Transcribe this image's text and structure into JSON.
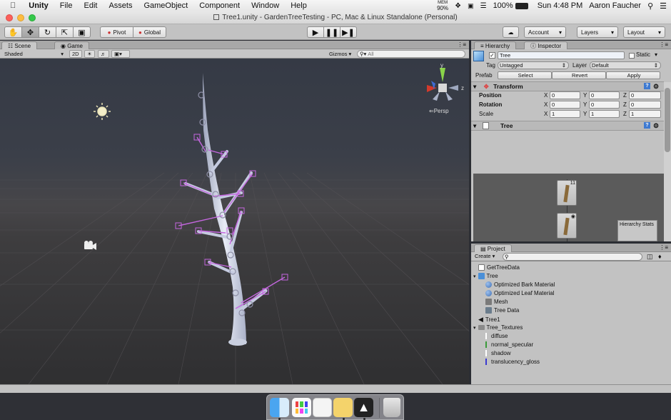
{
  "menubar": {
    "app": "Unity",
    "items": [
      "File",
      "Edit",
      "Assets",
      "GameObject",
      "Component",
      "Window",
      "Help"
    ],
    "mem_label": "MEM",
    "mem_value": "90%",
    "battery": "100%",
    "clock": "Sun 4:48 PM",
    "user": "Aaron Faucher"
  },
  "window": {
    "title": "Tree1.unity - GardenTreeTesting - PC, Mac & Linux Standalone (Personal)"
  },
  "toolbar": {
    "pivot": "Pivot",
    "global": "Global",
    "account": "Account",
    "layers": "Layers",
    "layout": "Layout"
  },
  "scene_tabs": {
    "scene": "Scene",
    "game": "Game",
    "shaded": "Shaded",
    "mode_2d": "2D",
    "gizmos": "Gizmos",
    "search_placeholder": "All"
  },
  "scene_view": {
    "persp": "Persp",
    "axis_y": "y",
    "axis_z": "z"
  },
  "right_tabs": {
    "hierarchy": "Hierarchy",
    "inspector": "Inspector"
  },
  "inspector": {
    "object_name": "Tree",
    "static_label": "Static",
    "tag_label": "Tag",
    "tag_value": "Untagged",
    "layer_label": "Layer",
    "layer_value": "Default",
    "prefab_label": "Prefab",
    "prefab_buttons": [
      "Select",
      "Revert",
      "Apply"
    ],
    "transform_title": "Transform",
    "transform": [
      {
        "label": "Position",
        "x": "0",
        "y": "0",
        "z": "0"
      },
      {
        "label": "Rotation",
        "x": "0",
        "y": "0",
        "z": "0"
      },
      {
        "label": "Scale",
        "x": "1",
        "y": "1",
        "z": "1"
      }
    ],
    "tree_title": "Tree",
    "hierarchy_stats": "Hierarchy Stats",
    "axis_labels": [
      "X",
      "Y",
      "Z"
    ]
  },
  "project": {
    "tab": "Project",
    "create": "Create",
    "items": [
      {
        "label": "GetTreeData",
        "icon": "script-icon",
        "color": "#ffffff"
      },
      {
        "label": "Tree",
        "icon": "prefab-icon",
        "color": "#4a8fd8"
      },
      {
        "label": "Optimized Bark Material",
        "icon": "material-icon",
        "color": "#3f6fb5"
      },
      {
        "label": "Optimized Leaf Material",
        "icon": "material-icon",
        "color": "#3f6fb5"
      },
      {
        "label": "Mesh",
        "icon": "mesh-icon",
        "color": "#7a7a7a"
      },
      {
        "label": "Tree Data",
        "icon": "data-icon",
        "color": "#6a7c8c"
      },
      {
        "label": "Tree1",
        "icon": "unity-scene-icon",
        "color": "#222222"
      },
      {
        "label": "Tree_Textures",
        "icon": "folder-icon",
        "color": "#8a8a8a"
      },
      {
        "label": "diffuse",
        "icon": "texture-icon",
        "color": "#ffffff"
      },
      {
        "label": "normal_specular",
        "icon": "texture-icon",
        "color": "#3a9a3a"
      },
      {
        "label": "shadow",
        "icon": "texture-icon",
        "color": "#ffffff"
      },
      {
        "label": "translucency_gloss",
        "icon": "texture-icon",
        "color": "#3a3ad0"
      }
    ]
  },
  "colors": {
    "accent_blue": "#3e7ad1",
    "branch_handle": "#c567e0",
    "tree_bark": "#cdd3e6"
  }
}
